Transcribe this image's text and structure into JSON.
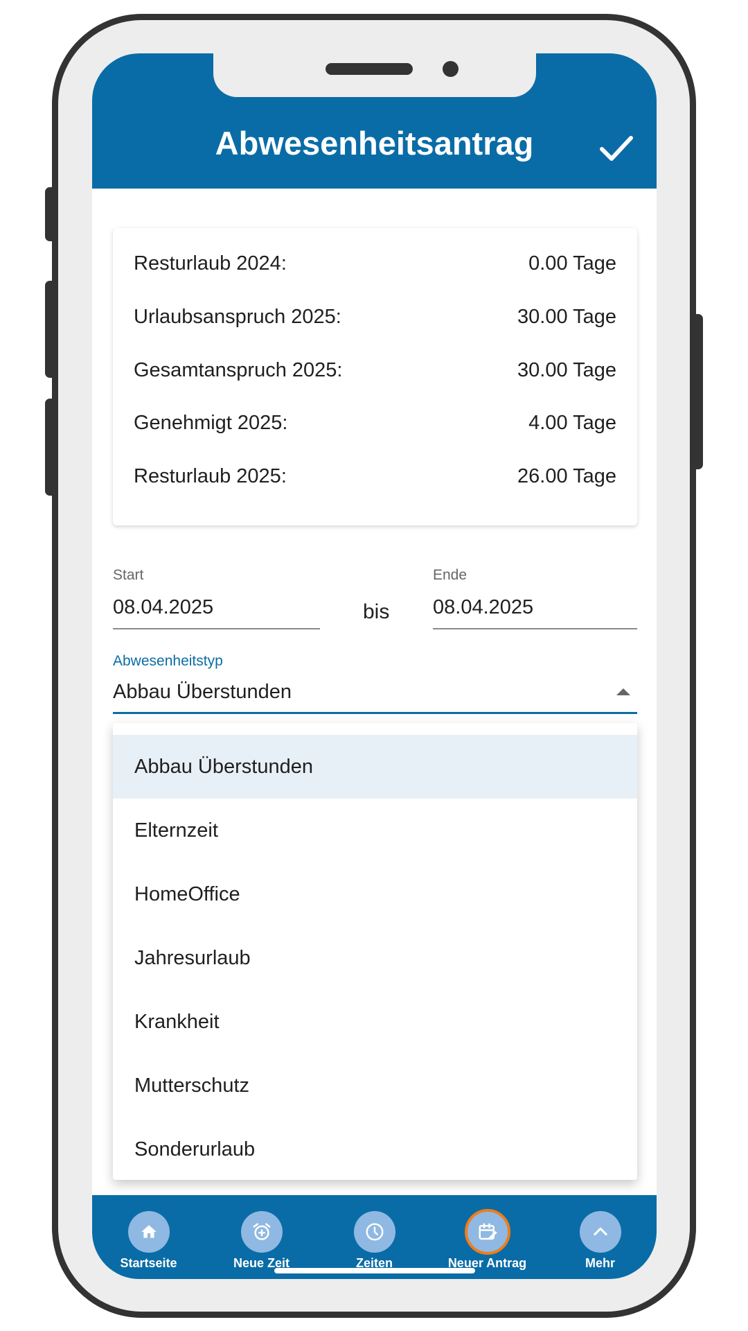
{
  "header": {
    "title": "Abwesenheitsantrag",
    "confirm_icon": "check-icon"
  },
  "summary": [
    {
      "label": "Resturlaub 2024:",
      "value": "0.00 Tage"
    },
    {
      "label": "Urlaubsanspruch 2025:",
      "value": "30.00 Tage"
    },
    {
      "label": "Gesamtanspruch 2025:",
      "value": "30.00 Tage"
    },
    {
      "label": "Genehmigt 2025:",
      "value": "4.00 Tage"
    },
    {
      "label": "Resturlaub 2025:",
      "value": "26.00 Tage"
    }
  ],
  "dates": {
    "start_label": "Start",
    "start_value": "08.04.2025",
    "separator": "bis",
    "end_label": "Ende",
    "end_value": "08.04.2025"
  },
  "absence_type": {
    "label": "Abwesenheitstyp",
    "selected": "Abbau Überstunden",
    "options": [
      "Abbau Überstunden",
      "Elternzeit",
      "HomeOffice",
      "Jahresurlaub",
      "Krankheit",
      "Mutterschutz",
      "Sonderurlaub"
    ]
  },
  "tabs": [
    {
      "label": "Startseite",
      "icon": "home-icon"
    },
    {
      "label": "Neue Zeit",
      "icon": "alarm-add-icon"
    },
    {
      "label": "Zeiten",
      "icon": "clock-icon"
    },
    {
      "label": "Neuer Antrag",
      "icon": "calendar-edit-icon",
      "active": true
    },
    {
      "label": "Mehr",
      "icon": "chevron-up-icon"
    }
  ],
  "colors": {
    "primary": "#0a6ca6",
    "accent": "#f07d1a",
    "selected_bg": "#e8f0f7",
    "tab_circle": "#8fb9e2"
  }
}
